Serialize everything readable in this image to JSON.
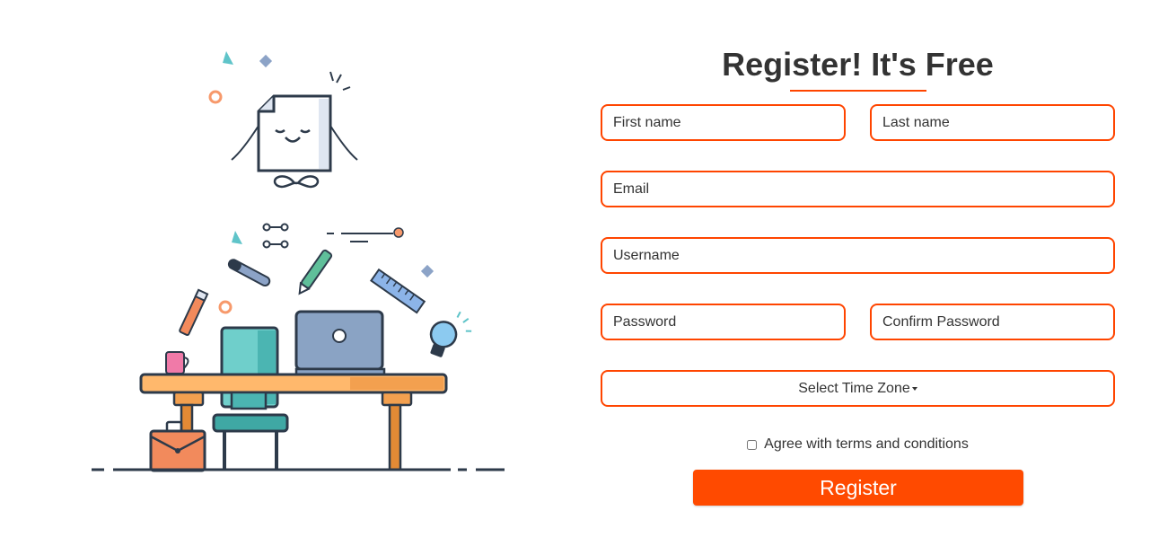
{
  "form": {
    "title": "Register! It's Free",
    "first_name_placeholder": "First name",
    "last_name_placeholder": "Last name",
    "email_placeholder": "Email",
    "username_placeholder": "Username",
    "password_placeholder": "Password",
    "confirm_password_placeholder": "Confirm Password",
    "timezone_label": "Select Time Zone",
    "terms_label": "Agree with terms and conditions",
    "terms_checked": false,
    "register_label": "Register"
  },
  "colors": {
    "accent": "#ff4500",
    "button": "#ff4a00",
    "text": "#333333"
  },
  "illustration": {
    "icons": [
      "happy-document-icon",
      "laptop-icon",
      "monitor-icon",
      "desk-icon",
      "chair-icon",
      "briefcase-icon",
      "mug-icon",
      "lightbulb-icon",
      "ruler-icon",
      "pen-icon",
      "brush-icon",
      "pencil-icon"
    ]
  }
}
